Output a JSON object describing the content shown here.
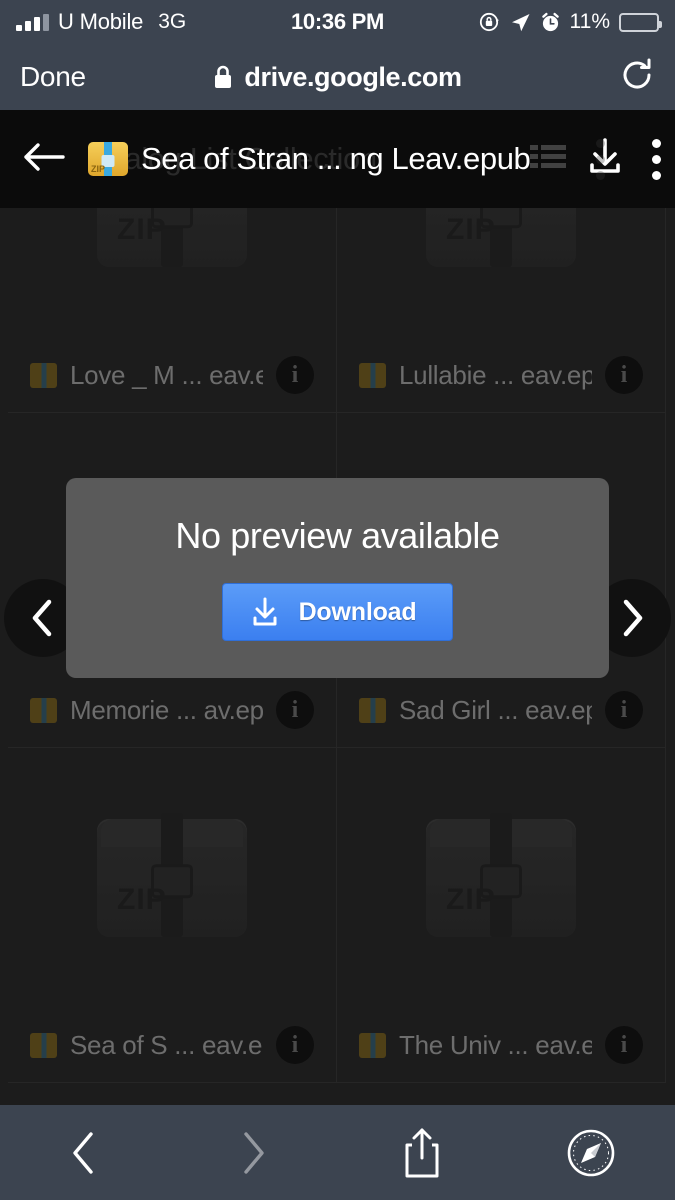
{
  "status_bar": {
    "carrier": "U Mobile",
    "network": "3G",
    "time": "10:36 PM",
    "battery_percent": "11%",
    "battery_level": 11,
    "battery_color": "#e8372c",
    "icons": [
      "signal-bars-icon",
      "rotation-lock-icon",
      "location-arrow-icon",
      "alarm-clock-icon",
      "battery-icon"
    ]
  },
  "browser": {
    "done_label": "Done",
    "url": "drive.google.com",
    "lock_icon": "lock-icon",
    "reload_icon": "reload-icon"
  },
  "app_header": {
    "back_icon": "back-arrow-icon",
    "file_icon": "zip-file-icon",
    "title": "Sea of Stran ... ng Leav.epub",
    "ghost_title": "Dialog List Collection",
    "list_icon": "list-view-icon",
    "download_icon": "download-icon",
    "more_icon": "more-vertical-icon"
  },
  "carousel": {
    "prev_icon": "chevron-left-icon",
    "next_icon": "chevron-right-icon"
  },
  "modal": {
    "title": "No preview available",
    "download_label": "Download",
    "download_icon": "download-icon",
    "button_color": "#4285f4"
  },
  "grid": {
    "rows": [
      {
        "cells": [
          {
            "label": "Love _ M ... eav.epub",
            "file_icon": "zip-file-icon",
            "info_icon": "info-icon",
            "thumb": "zip-archive-thumbnail"
          },
          {
            "label": "Lullabie ... eav.epub",
            "file_icon": "zip-file-icon",
            "info_icon": "info-icon",
            "thumb": "zip-archive-thumbnail"
          }
        ]
      },
      {
        "cells": [
          {
            "label": "Memorie ... av.epub",
            "file_icon": "zip-file-icon",
            "info_icon": "info-icon",
            "thumb": "zip-archive-thumbnail"
          },
          {
            "label": "Sad Girl ... eav.epub",
            "file_icon": "zip-file-icon",
            "info_icon": "info-icon",
            "thumb": "zip-archive-thumbnail"
          }
        ]
      },
      {
        "cells": [
          {
            "label": "Sea of S ... eav.epub",
            "file_icon": "zip-file-icon",
            "info_icon": "info-icon",
            "thumb": "zip-archive-thumbnail"
          },
          {
            "label": "The Univ ... eav.epub",
            "file_icon": "zip-file-icon",
            "info_icon": "info-icon",
            "thumb": "zip-archive-thumbnail"
          }
        ]
      }
    ],
    "info_glyph": "i",
    "zip_thumb_text": "ZIP"
  },
  "toolbar": {
    "back_icon": "chevron-left-icon",
    "forward_icon": "chevron-right-icon",
    "share_icon": "share-icon",
    "safari_icon": "safari-compass-icon",
    "back_enabled": true,
    "forward_enabled": false
  }
}
